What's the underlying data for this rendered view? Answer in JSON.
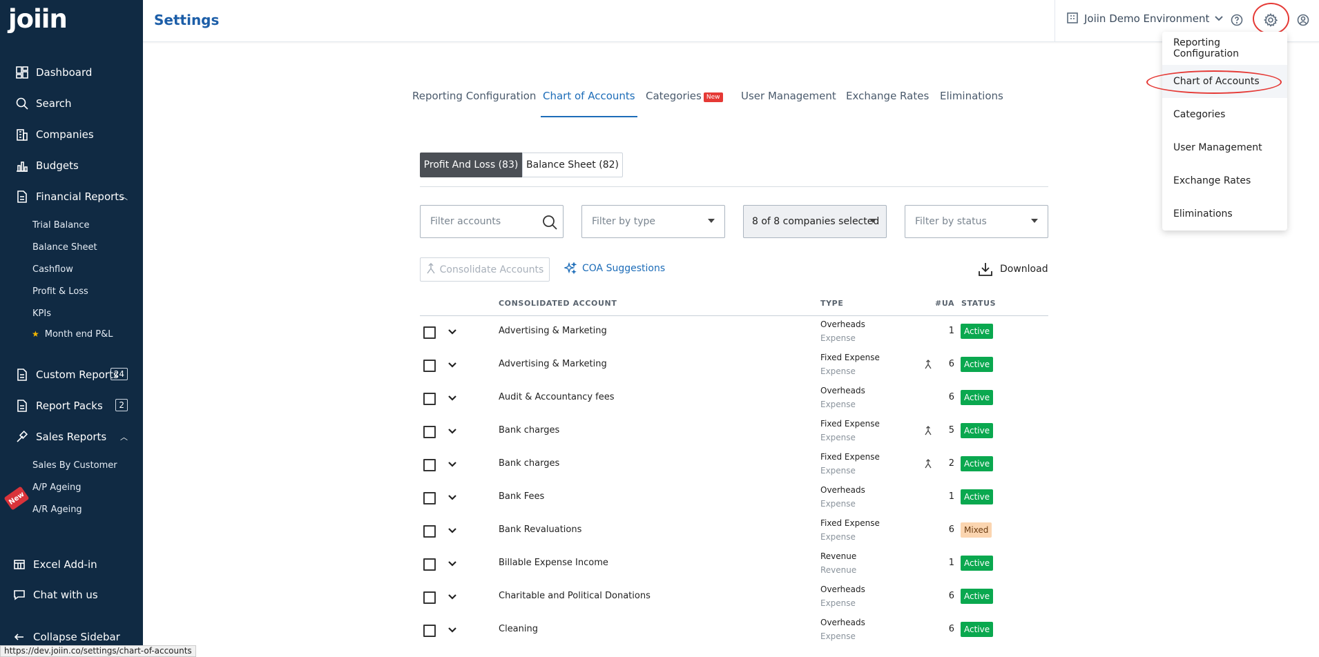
{
  "sidebar": {
    "logo": "joiin",
    "items": [
      {
        "label": "Dashboard",
        "icon": "dashboard-icon"
      },
      {
        "label": "Search",
        "icon": "search-icon"
      },
      {
        "label": "Companies",
        "icon": "building-icon"
      },
      {
        "label": "Budgets",
        "icon": "bar-chart-icon"
      },
      {
        "label": "Financial Reports",
        "icon": "document-icon"
      },
      {
        "label": "Custom Reports",
        "icon": "document-icon",
        "count": "24"
      },
      {
        "label": "Report Packs",
        "icon": "document-icon",
        "count": "2"
      },
      {
        "label": "Sales Reports",
        "icon": "gavel-icon"
      },
      {
        "label": "Excel Add-in",
        "icon": "table-icon"
      },
      {
        "label": "Chat with us",
        "icon": "chat-icon"
      },
      {
        "label": "Collapse Sidebar",
        "icon": "arrow-left-icon"
      }
    ],
    "financial_sub": [
      "Trial Balance",
      "Balance Sheet",
      "Cashflow",
      "Profit & Loss",
      "KPIs",
      "Month end P&L"
    ],
    "sales_sub": [
      "Sales By Customer",
      "A/P Ageing",
      "A/R Ageing"
    ],
    "new_ribbon": "New"
  },
  "header": {
    "title": "Settings",
    "environment": "Joiin Demo Environment"
  },
  "dropdown": {
    "items": [
      "Reporting Configuration",
      "Chart of Accounts",
      "Categories",
      "User Management",
      "Exchange Rates",
      "Eliminations"
    ]
  },
  "tabs": [
    {
      "label": "Reporting Configuration"
    },
    {
      "label": "Chart of Accounts"
    },
    {
      "label": "Categories",
      "badge": "New"
    },
    {
      "label": "User Management"
    },
    {
      "label": "Exchange Rates"
    },
    {
      "label": "Eliminations"
    }
  ],
  "segments": {
    "pl": "Profit And Loss (83)",
    "bs": "Balance Sheet (82)"
  },
  "filters": {
    "accounts_placeholder": "Filter accounts",
    "type_placeholder": "Filter by type",
    "companies_value": "8 of 8 companies selected",
    "status_placeholder": "Filter by status"
  },
  "actions": {
    "consolidate": "Consolidate Accounts",
    "coa": "COA Suggestions",
    "download": "Download"
  },
  "table": {
    "headers": {
      "account": "CONSOLIDATED ACCOUNT",
      "type": "TYPE",
      "ua": "#UA",
      "status": "STATUS"
    },
    "rows": [
      {
        "name": "Advertising & Marketing",
        "type": "Overheads",
        "subtype": "Expense",
        "ua": "1",
        "merged": false,
        "status": "Active"
      },
      {
        "name": "Advertising & Marketing",
        "type": "Fixed Expense",
        "subtype": "Expense",
        "ua": "6",
        "merged": true,
        "status": "Active"
      },
      {
        "name": "Audit & Accountancy fees",
        "type": "Overheads",
        "subtype": "Expense",
        "ua": "6",
        "merged": false,
        "status": "Active"
      },
      {
        "name": "Bank charges",
        "type": "Fixed Expense",
        "subtype": "Expense",
        "ua": "5",
        "merged": true,
        "status": "Active"
      },
      {
        "name": "Bank charges",
        "type": "Fixed Expense",
        "subtype": "Expense",
        "ua": "2",
        "merged": true,
        "status": "Active"
      },
      {
        "name": "Bank Fees",
        "type": "Overheads",
        "subtype": "Expense",
        "ua": "1",
        "merged": false,
        "status": "Active"
      },
      {
        "name": "Bank Revaluations",
        "type": "Fixed Expense",
        "subtype": "Expense",
        "ua": "6",
        "merged": false,
        "status": "Mixed"
      },
      {
        "name": "Billable Expense Income",
        "type": "Revenue",
        "subtype": "Revenue",
        "ua": "1",
        "merged": false,
        "status": "Active"
      },
      {
        "name": "Charitable and Political Donations",
        "type": "Overheads",
        "subtype": "Expense",
        "ua": "6",
        "merged": false,
        "status": "Active"
      },
      {
        "name": "Cleaning",
        "type": "Overheads",
        "subtype": "Expense",
        "ua": "6",
        "merged": false,
        "status": "Active"
      }
    ]
  },
  "status_bar_url": "https://dev.joiin.co/settings/chart-of-accounts",
  "colors": {
    "sidebar": "#102a43",
    "accent": "#1c6cb8",
    "active_status": "#0aa84f",
    "mixed_status": "#fbd5b0",
    "annotation": "#e53935"
  }
}
